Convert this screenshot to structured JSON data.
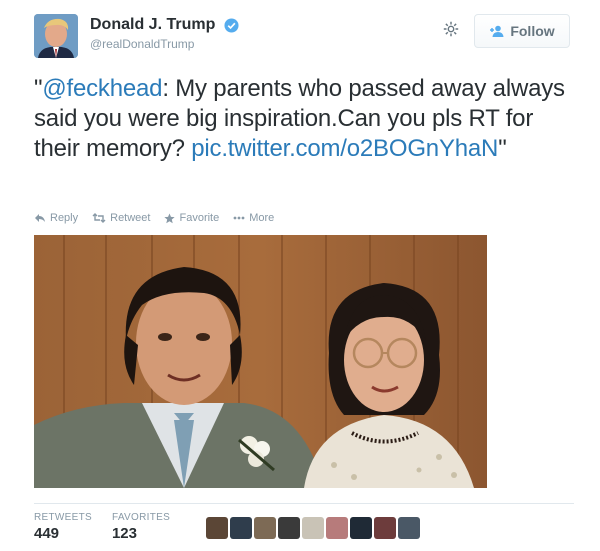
{
  "header": {
    "fullname": "Donald J. Trump",
    "username": "@realDonaldTrump",
    "follow_label": "Follow",
    "verified_icon": "verified-badge-icon",
    "settings_icon": "gear-icon"
  },
  "tweet": {
    "quote_open": "\"",
    "mention": "@feckhead",
    "body": ":  My parents who passed away always said you were big inspiration.Can you pls RT for their memory? ",
    "link": "pic.twitter.com/o2BOGnYhaN",
    "quote_close": "\""
  },
  "actions": {
    "reply": "Reply",
    "retweet": "Retweet",
    "favorite": "Favorite",
    "more": "More"
  },
  "stats": {
    "retweets_label": "RETWEETS",
    "retweets_value": "449",
    "favorites_label": "FAVORITES",
    "favorites_value": "123"
  },
  "colors": {
    "link": "#2b7bb9",
    "verified": "#55acee",
    "muted": "#8899a6"
  }
}
